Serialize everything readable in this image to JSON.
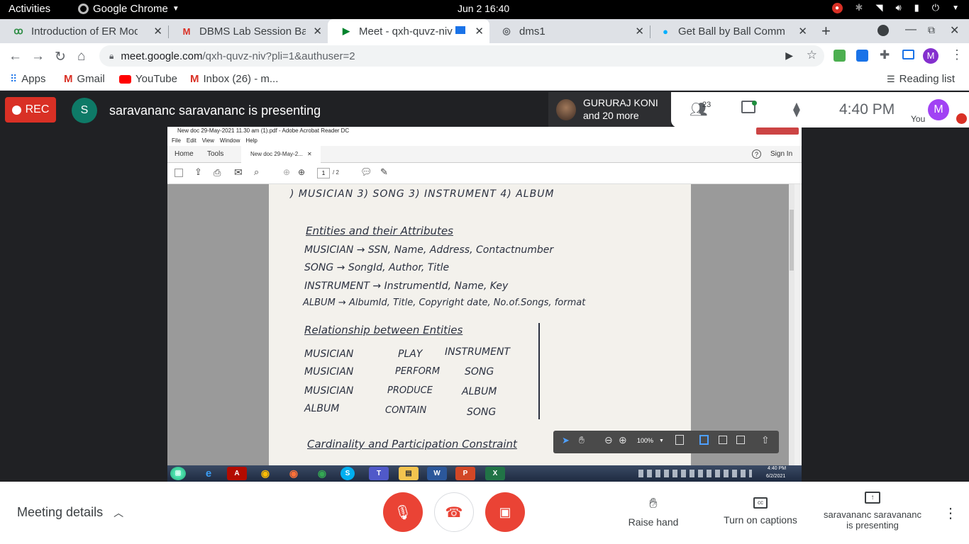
{
  "gnome": {
    "activities": "Activities",
    "app_name": "Google Chrome",
    "clock": "Jun 2  16:40"
  },
  "tabs": [
    {
      "title": "Introduction of ER Mode",
      "icon": "geeksforgeeks-icon",
      "active": false
    },
    {
      "title": "DBMS Lab Session Batch",
      "icon": "gmail-icon",
      "active": false
    },
    {
      "title": "Meet - qxh-quvz-niv",
      "icon": "meet-icon",
      "active": true
    },
    {
      "title": "dms1",
      "icon": "globe-icon",
      "active": false
    },
    {
      "title": "Get Ball by Ball Commen",
      "icon": "cricket-icon",
      "active": false
    }
  ],
  "omnibox": {
    "host": "meet.google.com",
    "path": "/qxh-quvz-niv?pli=1&authuser=2"
  },
  "bookmarks": {
    "apps": "Apps",
    "items": [
      "Gmail",
      "YouTube",
      "Inbox (26) - m..."
    ],
    "reading_list": "Reading list"
  },
  "profile_initial": "M",
  "meet": {
    "rec_label": "REC",
    "presenter_initial": "S",
    "presenting_text": "saravananc saravananc is presenting",
    "participant_name": "GURURAJ KONI",
    "participant_more": "and 20 more",
    "people_count": "23",
    "time": "4:40 PM",
    "you_label": "You",
    "you_initial": "M"
  },
  "acrobat": {
    "title": "New doc 29-May-2021 11.30 am (1).pdf - Adobe Acrobat Reader DC",
    "menu": [
      "File",
      "Edit",
      "View",
      "Window",
      "Help"
    ],
    "tabs": {
      "home": "Home",
      "tools": "Tools",
      "doc": "New doc 29-May-2..."
    },
    "sign_in": "Sign In",
    "page_current": "1",
    "page_total": "/ 2",
    "zoom": "100%"
  },
  "document": {
    "line0": ") MUSICIAN    3) SONG    3) INSTRUMENT    4) ALBUM",
    "heading1": "Entities and their Attributes",
    "attrs": [
      "MUSICIAN → SSN, Name, Address, Contactnumber",
      "SONG → SongId, Author, Title",
      "INSTRUMENT → InstrumentId, Name, Key",
      "ALBUM → AlbumId, Title, Copyright date, No.of.Songs, format"
    ],
    "heading2": "Relationship between Entities",
    "relations": [
      [
        "MUSICIAN",
        "PLAY",
        "INSTRUMENT"
      ],
      [
        "MUSICIAN",
        "PERFORM",
        "SONG"
      ],
      [
        "MUSICIAN",
        "PRODUCE",
        "ALBUM"
      ],
      [
        "ALBUM",
        "CONTAIN",
        "SONG"
      ]
    ],
    "heading3": "Cardinality and Participation Constraint"
  },
  "win_clock": {
    "time": "4:40 PM",
    "date": "6/2/2021"
  },
  "bottom": {
    "meeting_details": "Meeting details",
    "raise_hand": "Raise hand",
    "captions": "Turn on captions",
    "presenting_line1": "saravananc saravananc",
    "presenting_line2": "is presenting"
  },
  "colors": {
    "red": "#d93025",
    "meet_bg": "#202124",
    "avatar_teal": "#0e7a67",
    "profile_purple": "#8430ce"
  }
}
